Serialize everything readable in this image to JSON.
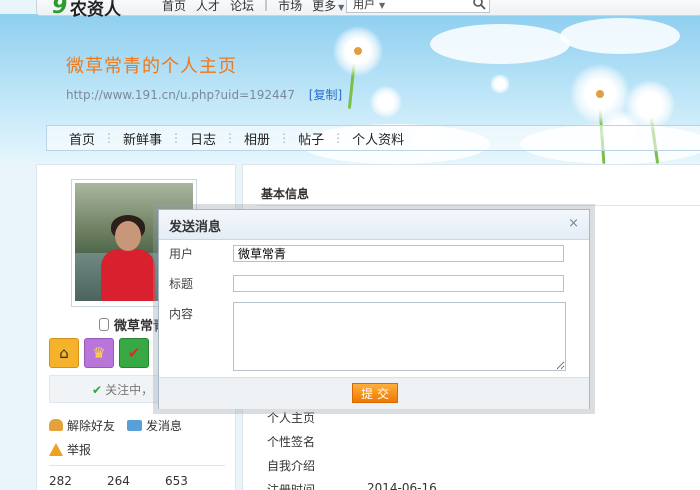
{
  "topbar": {
    "logo_mark": "9",
    "logo_text": "农资人",
    "nav": [
      "首页",
      "人才",
      "论坛",
      "市场",
      "更多"
    ],
    "search_scope": "用户"
  },
  "banner": {
    "title": "微草常青的个人主页",
    "url": "http://www.191.cn/u.php?uid=192447",
    "copy_label": "[复制]"
  },
  "tabs": [
    "首页",
    "新鲜事",
    "日志",
    "相册",
    "帖子",
    "个人资料"
  ],
  "profile": {
    "name": "微草常青",
    "follow_text": "关注中，",
    "actions": {
      "unfriend": "解除好友",
      "send_message": "发消息",
      "report": "举报"
    },
    "stats": [
      "282",
      "264",
      "653"
    ]
  },
  "info": {
    "section_title": "基本信息",
    "rows": [
      {
        "label": "个人主页",
        "value": ""
      },
      {
        "label": "个性签名",
        "value": ""
      },
      {
        "label": "自我介绍",
        "value": ""
      },
      {
        "label": "注册时间",
        "value": "2014-06-16"
      }
    ]
  },
  "modal": {
    "title": "发送消息",
    "close": "×",
    "user_label": "用户",
    "user_value": "微草常青",
    "subject_label": "标题",
    "subject_value": "",
    "content_label": "内容",
    "content_value": "",
    "submit_label": "提交"
  },
  "colors": {
    "title_orange": "#f07818",
    "link_blue": "#2a6fc9",
    "submit_orange": "#f28a10"
  }
}
